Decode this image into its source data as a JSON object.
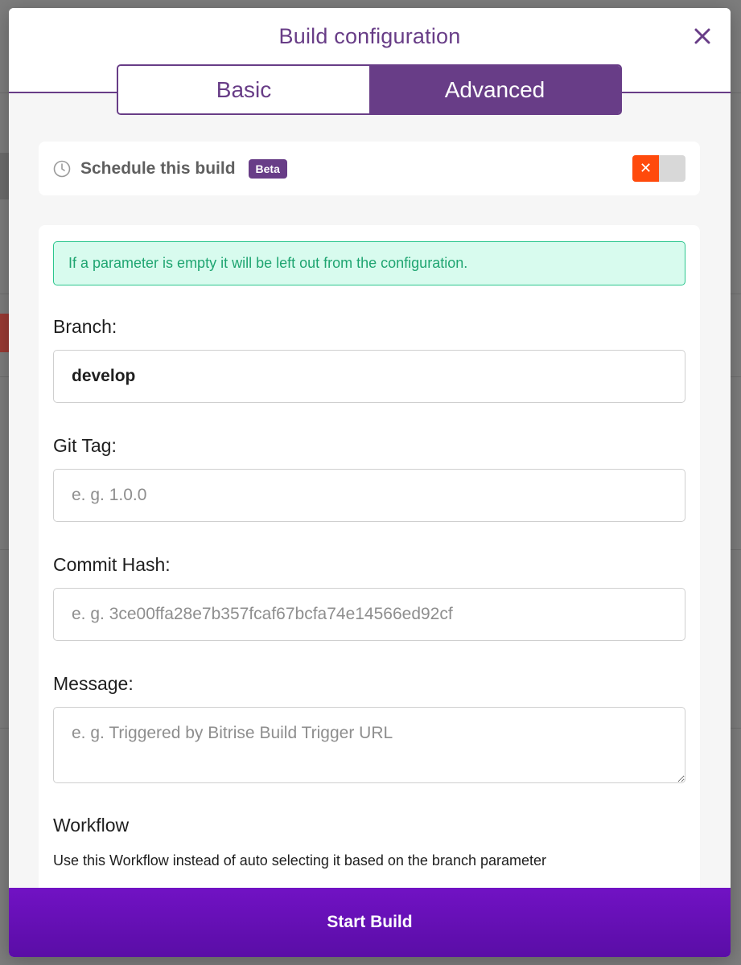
{
  "modal": {
    "title": "Build configuration",
    "close_icon": "close-icon",
    "tabs": [
      {
        "label": "Basic",
        "active": false
      },
      {
        "label": "Advanced",
        "active": true
      }
    ]
  },
  "schedule": {
    "icon": "clock-icon",
    "label": "Schedule this build",
    "badge": "Beta",
    "toggle_state": "off",
    "toggle_icon": "x-icon"
  },
  "form": {
    "info": "If a parameter is empty it will be left out from the configuration.",
    "branch": {
      "label": "Branch:",
      "value": "develop"
    },
    "git_tag": {
      "label": "Git Tag:",
      "placeholder": "e. g. 1.0.0"
    },
    "commit_hash": {
      "label": "Commit Hash:",
      "placeholder": "e. g. 3ce00ffa28e7b357fcaf67bcfa74e14566ed92cf"
    },
    "message": {
      "label": "Message:",
      "placeholder": "e. g. Triggered by Bitrise Build Trigger URL"
    },
    "workflow": {
      "label": "Workflow",
      "helper": "Use this Workflow instead of auto selecting it based on the branch parameter"
    }
  },
  "footer": {
    "start_label": "Start Build"
  },
  "colors": {
    "brand": "#683d87",
    "primary_button": "#6a10b8",
    "toggle_off": "#ff4a0c",
    "info_bg": "#d8fbee",
    "info_text": "#1fa571"
  }
}
